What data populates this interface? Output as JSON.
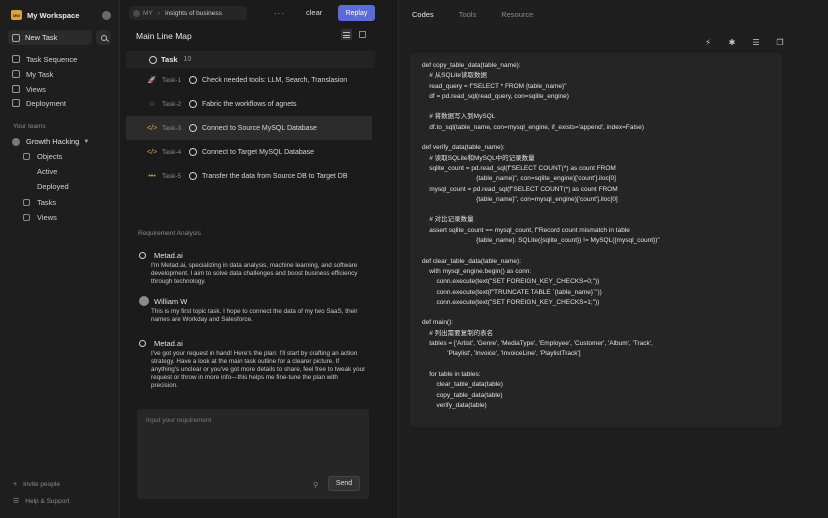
{
  "workspace": {
    "logo": "MW",
    "name": "My Workspace"
  },
  "sidebar": {
    "new_task": "New Task",
    "items": [
      {
        "label": "Task Sequence",
        "icon": "task-sequence-icon"
      },
      {
        "label": "My Task",
        "icon": "my-task-icon"
      },
      {
        "label": "Views",
        "icon": "views-icon"
      },
      {
        "label": "Deployment",
        "icon": "deployment-icon"
      }
    ],
    "teams_label": "Your teams",
    "team": {
      "name": "Growth Hacking",
      "items": [
        {
          "label": "Objects"
        },
        {
          "label": "Active"
        },
        {
          "label": "Deployed"
        },
        {
          "label": "Tasks"
        },
        {
          "label": "Views"
        }
      ]
    },
    "footer": {
      "invite": "Invite people",
      "help": "Help & Support"
    }
  },
  "header": {
    "crumb_root": "MY",
    "crumb_page": "insights of business",
    "more": "···",
    "clear": "clear",
    "replay": "Replay"
  },
  "main": {
    "title": "Main Line Map",
    "task_header": {
      "label": "Task",
      "count": "10"
    },
    "tasks": [
      {
        "id": "Task-1",
        "name": "Check needed tools: LLM, Search, Translasion",
        "icon": "rocket-icon",
        "icon_color": "#e0a44a"
      },
      {
        "id": "Task-2",
        "name": "Fabric the workflows of agnets",
        "icon": "star-icon",
        "icon_color": "#e0a44a"
      },
      {
        "id": "Task-3",
        "name": "Connect to Source MySQL Database",
        "icon": "code-icon",
        "icon_color": "#e0a44a"
      },
      {
        "id": "Task-4",
        "name": "Connect to Target MySQL Database",
        "icon": "code-icon",
        "icon_color": "#e0a44a"
      },
      {
        "id": "Task-5",
        "name": "Transfer the data from Source DB to Target DB",
        "icon": "ellipsis-icon",
        "icon_color": "#e0a44a"
      }
    ],
    "requirement_label": "Requirement Analysis",
    "messages": [
      {
        "author": "Metad.ai",
        "body": "I'm Metad.ai, specializing in data analysis, machine learning, and software development. I aim to solve data challenges and boost business efficiency through technology."
      },
      {
        "author": "William W",
        "body": "This is my first topic task. I hope to connect the data of my two SaaS, their names are Workday and Salesforce."
      },
      {
        "author": "Metad.ai",
        "body": "I've got your request in hand! Here's the plan: I'll start by crafting an action strategy. Have a look at the main task outline for a clearer picture. If anything's unclear or you've got more details to share, feel free to tweak your request or throw in more info—this helps me fine-tune the plan with precision."
      }
    ],
    "input": {
      "placeholder": "Input your requirement",
      "send": "Send"
    }
  },
  "right": {
    "tabs": [
      "Codes",
      "Tools",
      "Resource"
    ],
    "active_tab": "Codes",
    "code": "def copy_table_data(table_name):\n    # 从SQLite读取数据\n    read_query = f\"SELECT * FROM {table_name}\"\n    df = pd.read_sql(read_query, con=sqlite_engine)\n\n    # 将数据写入到MySQL\n    df.to_sql(table_name, con=mysql_engine, if_exists='append', index=False)\n\ndef verify_data(table_name):\n    # 读取SQLite和MySQL中的记录数量\n    sqlite_count = pd.read_sql(f\"SELECT COUNT(*) as count FROM\n                              {table_name}\", con=sqlite_engine)['count'].iloc[0]\n    mysql_count = pd.read_sql(f\"SELECT COUNT(*) as count FROM\n                              {table_name}\", con=mysql_engine)['count'].iloc[0]\n\n    # 对比记录数量\n    assert sqlite_count == mysql_count, f\"Record count mismatch in table\n                              {table_name}: SQLite({sqlite_count}) != MySQL({mysql_count})\"\n\ndef clear_table_data(table_name):\n    with mysql_engine.begin() as conn:\n        conn.execute(text(\"SET FOREIGN_KEY_CHECKS=0;\"))\n        conn.execute(text(f\"TRUNCATE TABLE `{table_name}`\"))\n        conn.execute(text(\"SET FOREIGN_KEY_CHECKS=1;\"))\n\ndef main():\n    # 列出需要复制的表名\n    tables = ['Artist', 'Genre', 'MediaType', 'Employee', 'Customer', 'Album', 'Track',\n              'Playlist', 'Invoice', 'InvoiceLine', 'PlaylistTrack']\n\n    for table in tables:\n        clear_table_data(table)\n        copy_table_data(table)\n        verify_data(table)"
  },
  "colors": {
    "accent": "#5b6bd8",
    "task_icon": "#e0a44a",
    "logo": "#d9a43a"
  }
}
